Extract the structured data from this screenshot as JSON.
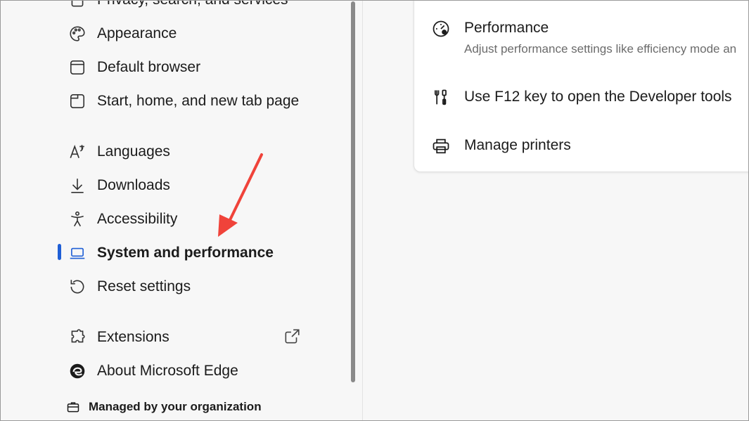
{
  "sidebar": {
    "items": [
      {
        "label": "Privacy, search, and services",
        "icon": "lock-icon"
      },
      {
        "label": "Appearance",
        "icon": "palette-icon"
      },
      {
        "label": "Default browser",
        "icon": "browser-window-icon"
      },
      {
        "label": "Start, home, and new tab page",
        "icon": "home-tab-icon"
      },
      {
        "label": "Languages",
        "icon": "languages-icon"
      },
      {
        "label": "Downloads",
        "icon": "download-icon"
      },
      {
        "label": "Accessibility",
        "icon": "accessibility-icon"
      },
      {
        "label": "System and performance",
        "icon": "laptop-icon",
        "active": true
      },
      {
        "label": "Reset settings",
        "icon": "reset-icon"
      },
      {
        "label": "Extensions",
        "icon": "puzzle-icon"
      },
      {
        "label": "About Microsoft Edge",
        "icon": "edge-logo-icon"
      }
    ],
    "managed_label": "Managed by your organization"
  },
  "main": {
    "rows": [
      {
        "title": "Performance",
        "subtitle": "Adjust performance settings like efficiency mode an",
        "icon": "performance-gauge-icon"
      },
      {
        "title": "Use F12 key to open the Developer tools",
        "icon": "developer-tools-icon"
      },
      {
        "title": "Manage printers",
        "icon": "printer-icon"
      }
    ]
  },
  "colors": {
    "accent": "#1f5fd6",
    "annotation_arrow": "#f0433a"
  }
}
